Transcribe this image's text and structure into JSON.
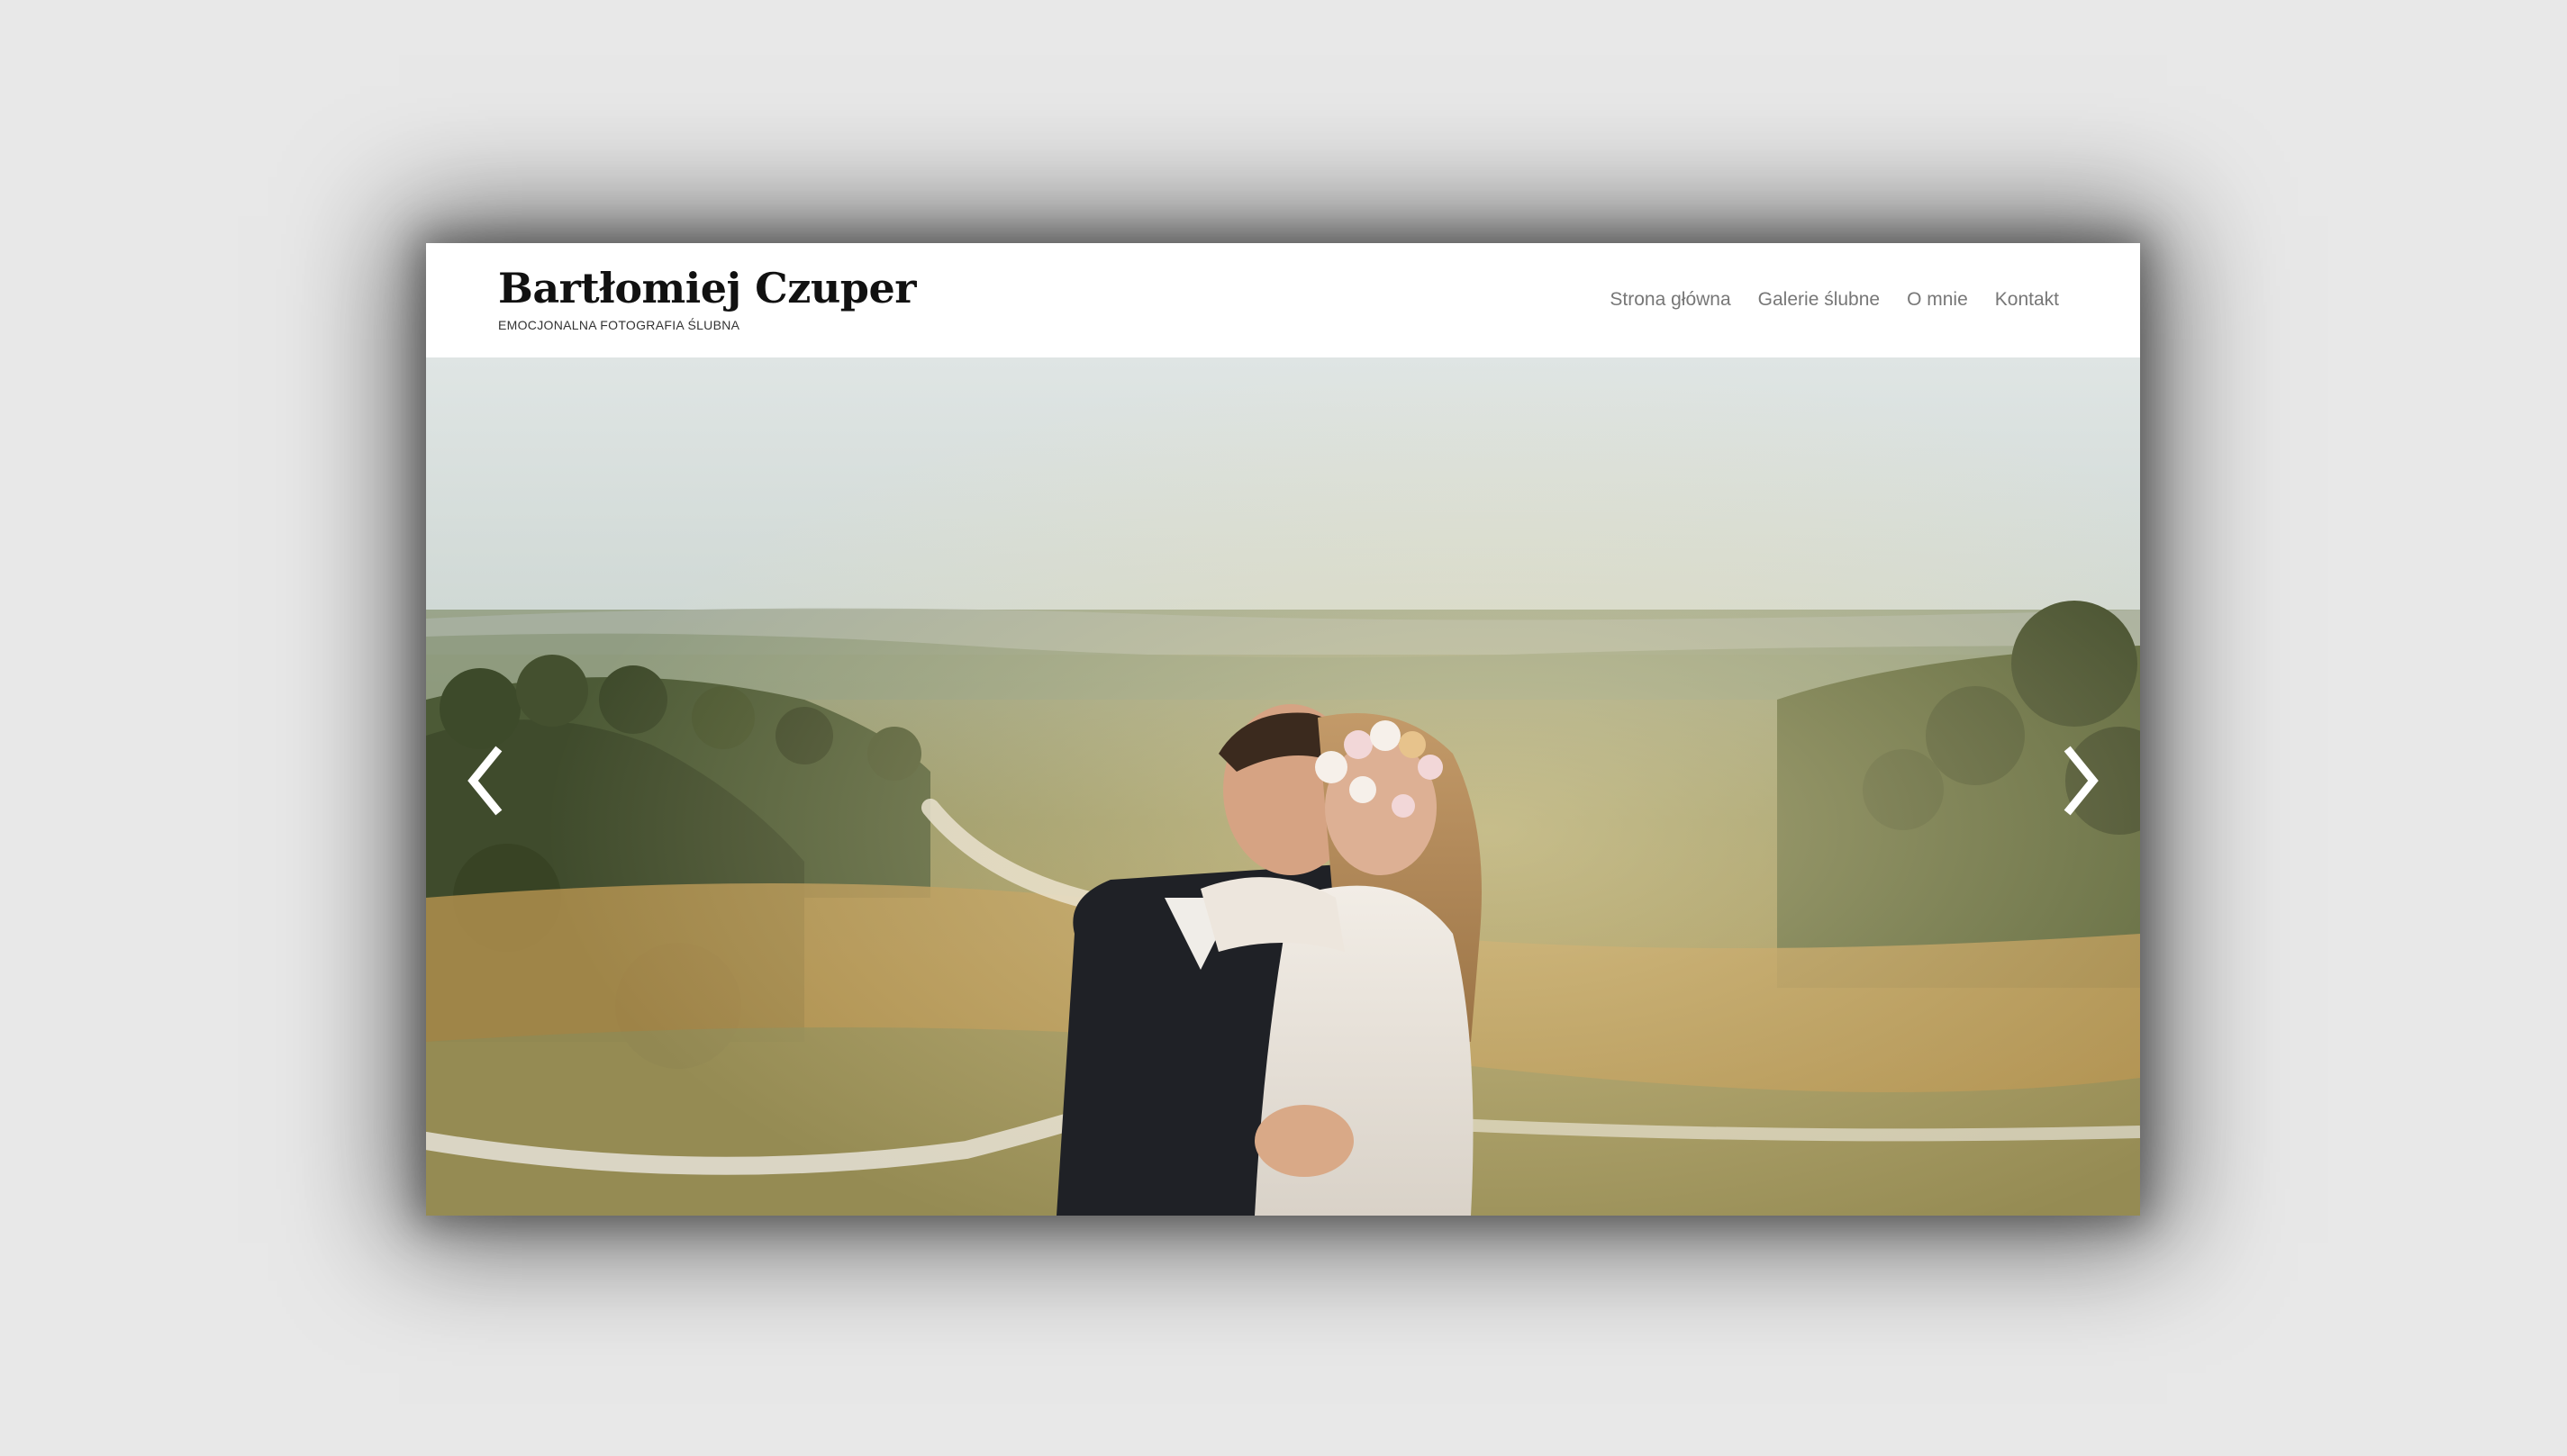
{
  "site": {
    "title": "Bartłomiej Czuper",
    "tagline": "EMOCJONALNA FOTOGRAFIA ŚLUBNA"
  },
  "nav": {
    "items": [
      {
        "label": "Strona główna"
      },
      {
        "label": "Galerie ślubne"
      },
      {
        "label": "O mnie"
      },
      {
        "label": "Kontakt"
      }
    ]
  },
  "hero": {
    "icons": {
      "prev": "chevron-left-icon",
      "next": "chevron-right-icon"
    }
  },
  "colors": {
    "background": "#e8e8e8",
    "header": "#ffffff",
    "title": "#111111",
    "nav": "#777777",
    "arrow": "#ffffff"
  }
}
